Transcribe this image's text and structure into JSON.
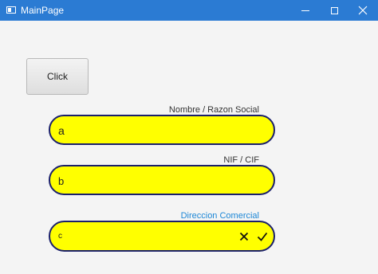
{
  "window": {
    "title": "MainPage",
    "icon": "app-window-icon",
    "controls": [
      "minimize-icon",
      "maximize-icon",
      "close-icon"
    ]
  },
  "main": {
    "click_button": "Click",
    "fields": [
      {
        "label": "Nombre / Razon Social",
        "value": "a"
      },
      {
        "label": "NIF / CIF",
        "value": "b"
      },
      {
        "label": "Direccion Comercial",
        "value": "c",
        "focused": true
      }
    ],
    "field_icons": [
      "clear-icon",
      "check-icon"
    ]
  },
  "colors": {
    "titlebar": "#2b7bd3",
    "field_fill": "#ffff00",
    "field_border": "#1a1f6b",
    "focused_label": "#1c86d6"
  }
}
